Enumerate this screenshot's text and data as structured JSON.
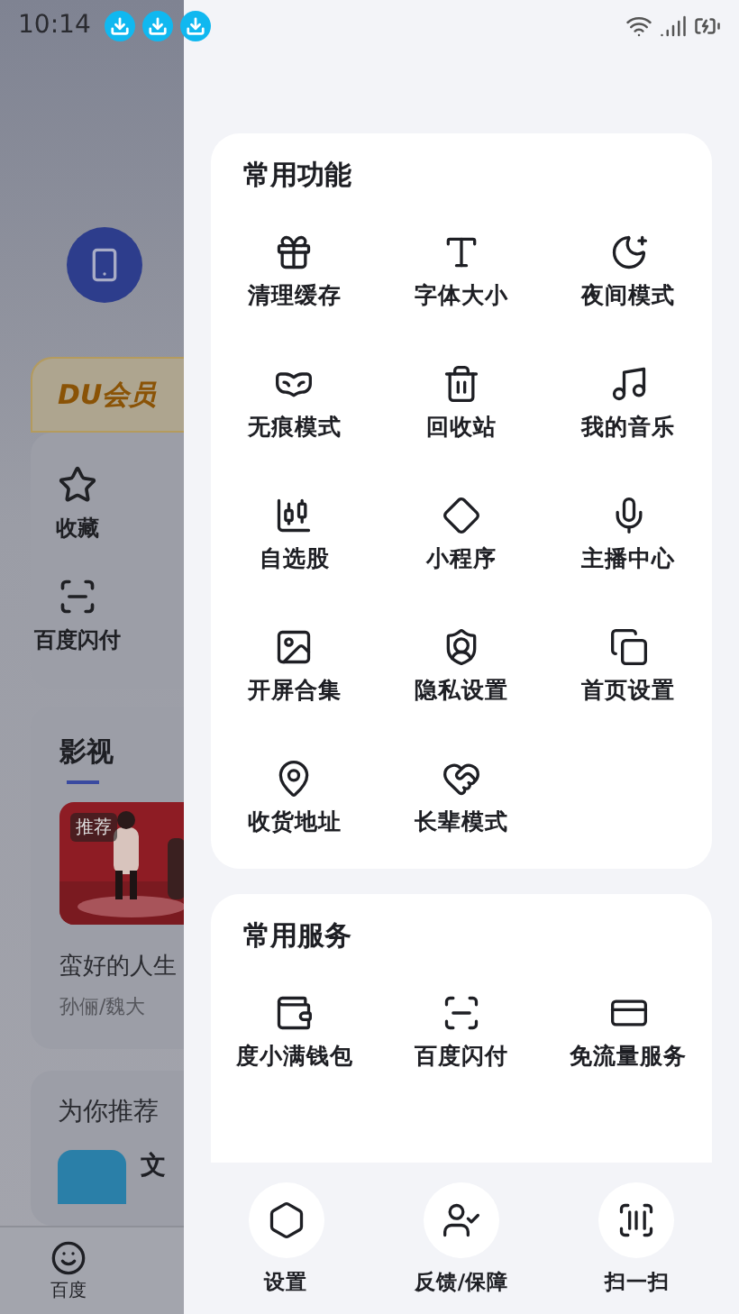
{
  "status_bar": {
    "time": "10:14"
  },
  "background": {
    "vip_badge": "DU会员",
    "shortcuts": [
      "收藏",
      "百度闪付"
    ],
    "video_section": {
      "title": "影视",
      "tag": "推荐",
      "caption": "蛮好的人生",
      "subtitle": "孙俪/魏大"
    },
    "recommend": {
      "title": "为你推荐",
      "item": "文"
    },
    "tabbar": [
      {
        "label": "百度",
        "selected": true
      }
    ]
  },
  "sections": [
    {
      "title": "常用功能",
      "items": [
        "清理缓存",
        "字体大小",
        "夜间模式",
        "无痕模式",
        "回收站",
        "我的音乐",
        "自选股",
        "小程序",
        "主播中心",
        "开屏合集",
        "隐私设置",
        "首页设置",
        "收货地址",
        "长辈模式"
      ]
    },
    {
      "title": "常用服务",
      "items": [
        "度小满钱包",
        "百度闪付",
        "免流量服务"
      ]
    }
  ],
  "bottom_actions": [
    "设置",
    "反馈/保障",
    "扫一扫"
  ]
}
